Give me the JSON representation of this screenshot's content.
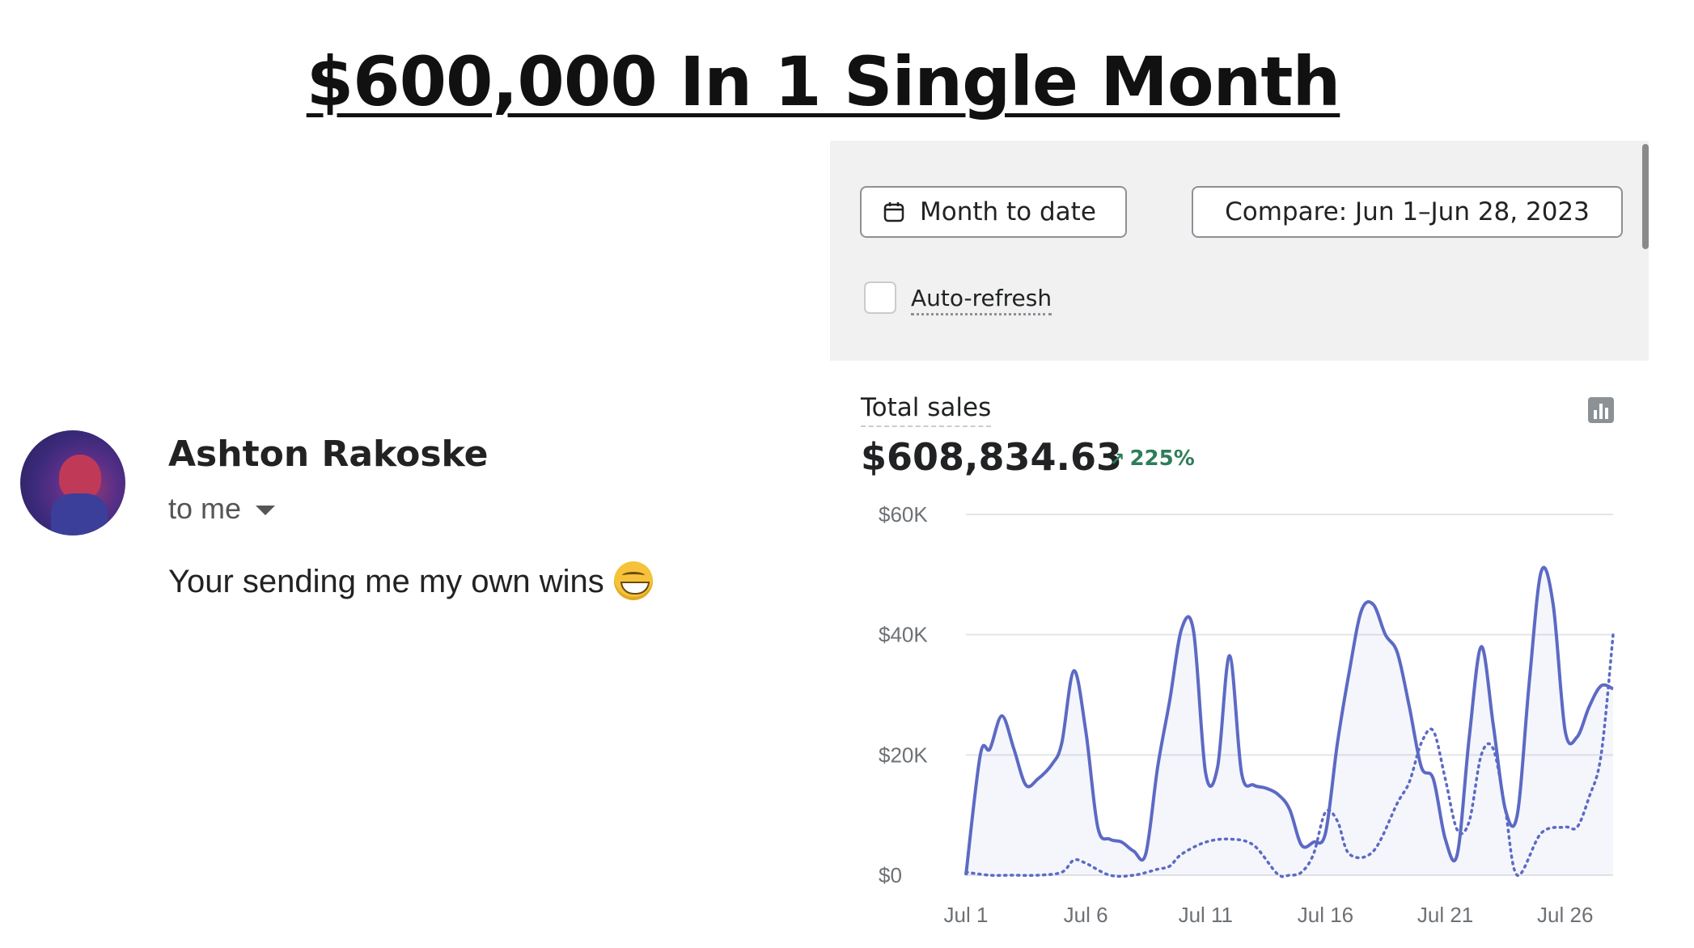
{
  "headline": "$600,000 In 1 Single Month",
  "email": {
    "sender_name": "Ashton Rakoske",
    "recipient_line": "to me",
    "message": "Your sending me my own wins",
    "emoji_icon": "grinning-face-emoji"
  },
  "dashboard": {
    "date_button_label": "Month to date",
    "compare_button_label": "Compare: Jun 1–Jun 28, 2023",
    "auto_refresh_label": "Auto-refresh",
    "auto_refresh_checked": false,
    "card_title": "Total sales",
    "total_value": "$608,834.63",
    "delta_percent": "225%",
    "delta_arrow": "↗",
    "colors": {
      "current_line": "#5c6ac4",
      "comparison_line": "#5c6ac4",
      "positive": "#2e7d5b"
    }
  },
  "chart_data": {
    "type": "line",
    "title": "Total sales",
    "y_tick_labels": [
      "$0",
      "$20K",
      "$40K",
      "$60K"
    ],
    "y_ticks": [
      0,
      20000,
      40000,
      60000
    ],
    "ylim": [
      0,
      60000
    ],
    "x_tick_labels": [
      "Jul 1",
      "Jul 6",
      "Jul 11",
      "Jul 16",
      "Jul 21",
      "Jul 26"
    ],
    "x_ticks": [
      1,
      6,
      11,
      16,
      21,
      26
    ],
    "xlim": [
      1,
      28
    ],
    "grid": true,
    "series": [
      {
        "style": "solid",
        "x": [
          1,
          1.6,
          2,
          2.5,
          3,
          3.5,
          4,
          4.6,
          5,
          5.5,
          6,
          6.5,
          7,
          7.5,
          8,
          8.5,
          9,
          9.5,
          10,
          10.5,
          11,
          11.5,
          12,
          12.5,
          13,
          13.5,
          14,
          14.5,
          15,
          15.5,
          16,
          16.5,
          17,
          17.5,
          18,
          18.5,
          19,
          19.5,
          20,
          20.5,
          21,
          21.5,
          22,
          22.5,
          23,
          23.5,
          24,
          24.5,
          25,
          25.5,
          26,
          26.5,
          27,
          27.5,
          28
        ],
        "values": [
          0,
          20000,
          21000,
          26500,
          21000,
          15000,
          16000,
          18500,
          22000,
          34000,
          24000,
          8000,
          6000,
          5500,
          4000,
          3500,
          18000,
          29000,
          41000,
          40500,
          17000,
          18000,
          36500,
          17000,
          15000,
          14500,
          13500,
          11000,
          5000,
          5500,
          7000,
          22000,
          34000,
          44000,
          45000,
          40000,
          37000,
          28000,
          18000,
          16000,
          6000,
          3500,
          23000,
          38000,
          25000,
          11000,
          10000,
          32000,
          50500,
          45000,
          24000,
          23000,
          28000,
          31500,
          31000
        ]
      },
      {
        "style": "dotted",
        "x": [
          1,
          2,
          3,
          4,
          5,
          5.5,
          6,
          7,
          8,
          9,
          9.5,
          10,
          11,
          12,
          13,
          14,
          14.5,
          15,
          15.5,
          16,
          16.5,
          17,
          18,
          19,
          19.5,
          20,
          20.5,
          21,
          21.5,
          22,
          22.5,
          23,
          23.5,
          24,
          25,
          26,
          26.5,
          27,
          27.5,
          28
        ],
        "values": [
          500,
          0,
          0,
          0,
          500,
          2500,
          2000,
          0,
          0,
          1000,
          1500,
          3500,
          5500,
          6000,
          5000,
          200,
          0,
          500,
          3500,
          10500,
          9000,
          3500,
          4000,
          12000,
          15500,
          22000,
          24000,
          16000,
          7500,
          9000,
          20000,
          21000,
          11000,
          0,
          7000,
          8000,
          8000,
          13000,
          20000,
          40000
        ]
      }
    ]
  }
}
